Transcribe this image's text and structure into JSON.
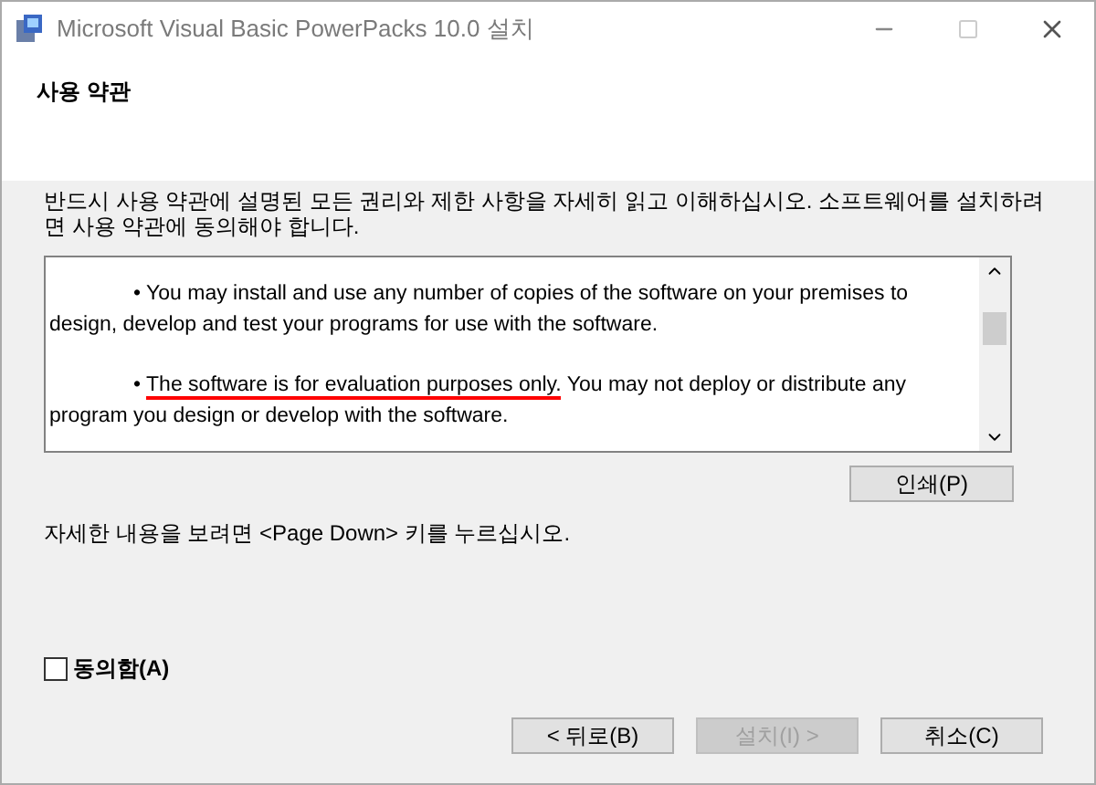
{
  "window": {
    "title": "Microsoft Visual Basic PowerPacks 10.0 설치"
  },
  "header": {
    "title": "사용 약관"
  },
  "instructions": "반드시 사용 약관에 설명된 모든 권리와 제한 사항을 자세히 읽고 이해하십시오. 소프트웨어를 설치하려면 사용 약관에 동의해야 합니다.",
  "license_items": [
    {
      "bullet": "•",
      "text": "You may install and use any number of copies of the software on your premises to design, develop and test your programs for use with the software."
    },
    {
      "bullet": "•",
      "underlined": "The software is for evaluation purposes only.",
      "text": " You may not deploy or distribute any program you design or develop with the software."
    }
  ],
  "print_button": "인쇄(P)",
  "page_down_hint": "자세한 내용을 보려면 <Page Down> 키를 누르십시오.",
  "agree_checkbox": {
    "label": "동의함(A)",
    "checked": false
  },
  "buttons": [
    {
      "label": "< 뒤로(B)",
      "disabled": false
    },
    {
      "label": "설치(I) >",
      "disabled": true
    },
    {
      "label": "취소(C)",
      "disabled": false
    }
  ]
}
